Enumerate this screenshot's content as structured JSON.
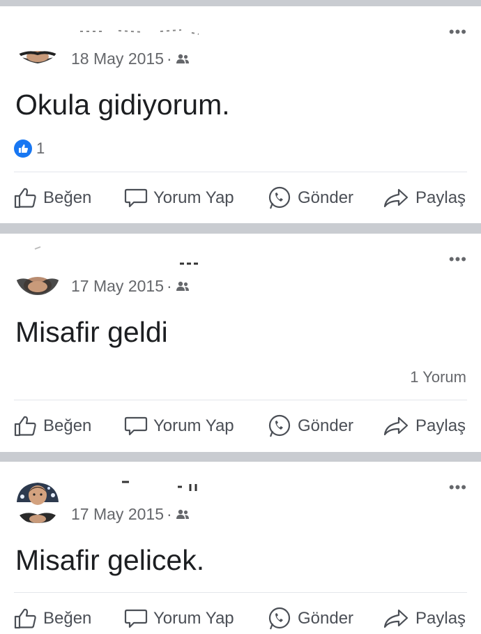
{
  "posts": [
    {
      "date": "18 May 2015",
      "dot": "·",
      "audience_icon": "friends-icon",
      "text": "Okula gidiyorum.",
      "reaction_count": "1",
      "comment_count": "",
      "more": "•••"
    },
    {
      "date": "17 May 2015",
      "dot": "·",
      "audience_icon": "friends-icon",
      "text": "Misafir geldi",
      "reaction_count": "",
      "comment_count": "1 Yorum",
      "more": "•••"
    },
    {
      "date": "17 May 2015",
      "dot": "·",
      "audience_icon": "friends-icon",
      "text": "Misafir gelicek.",
      "reaction_count": "",
      "comment_count": "",
      "more": "•••"
    }
  ],
  "actions": {
    "like": "Beğen",
    "comment": "Yorum Yap",
    "send": "Gönder",
    "share": "Paylaş"
  },
  "colors": {
    "separator": "#c9ccd1",
    "like_blue": "#1877f2",
    "secondary_text": "#65676b"
  }
}
